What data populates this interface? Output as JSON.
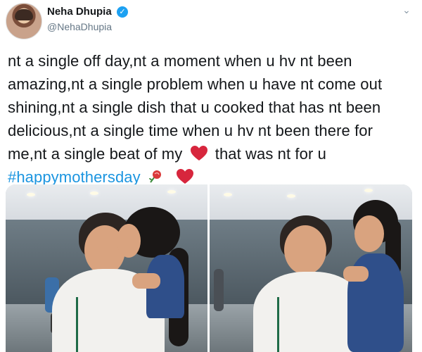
{
  "tweet": {
    "author_name": "Neha Dhupia",
    "author_handle": "@NehaDhupia",
    "lines": [
      "nt a single off day,nt a moment when u hv nt been",
      "amazing,nt a single problem when u have nt come out",
      "shining,nt a single dish that u  cooked that has nt been",
      "delicious,nt a single time when u hv nt been there for"
    ],
    "line5_before_heart": "me,nt a single beat of my",
    "line5_after_heart": "that was nt for u",
    "hashtag": "#happymothersday",
    "icons": {
      "verified": "verified-badge-icon",
      "menu": "chevron-down-icon",
      "heart": "red-heart-emoji",
      "rose": "rose-emoji"
    },
    "colors": {
      "hashtag": "#1b95e0",
      "verified": "#1da1f2",
      "heart": "#d7263d"
    }
  },
  "media": {
    "photos": [
      "photo-1",
      "photo-2"
    ]
  }
}
